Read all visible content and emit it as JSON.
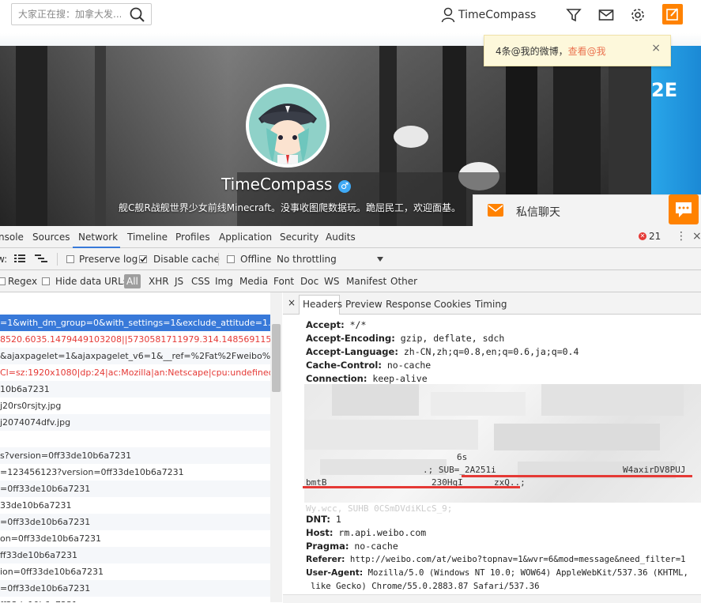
{
  "topbar": {
    "search_placeholder": "大家正在搜：加拿大发...",
    "username": "TimeCompass"
  },
  "notification": {
    "text": "4条@我的微博，",
    "link": "查看@我",
    "close": "×"
  },
  "banner": {
    "right_text": "2E"
  },
  "profile": {
    "name": "TimeCompass",
    "gender_icon": "♂",
    "bio": "舰C舰R战舰世界少女前线Minecraft。没事收图爬数据玩。跪屈民工，欢迎面基。"
  },
  "chat": {
    "label": "私信聊天"
  },
  "devtools": {
    "tabs": [
      "nsole",
      "Sources",
      "Network",
      "Timeline",
      "Profiles",
      "Application",
      "Security",
      "Audits"
    ],
    "error_count": "21",
    "more": "⋮",
    "close": "×",
    "toolbar": {
      "view_label": "w:",
      "preserve_log": "Preserve log",
      "disable_cache": "Disable cache",
      "offline": "Offline",
      "throttling": "No throttling"
    },
    "filter": {
      "regex": "Regex",
      "hide_data_urls": "Hide data URLs",
      "types": [
        "All",
        "XHR",
        "JS",
        "CSS",
        "Img",
        "Media",
        "Font",
        "Doc",
        "WS",
        "Manifest",
        "Other"
      ]
    },
    "requests": [
      "=1&with_dm_group=0&with_settings=1&exclude_attitude=1...",
      "8520.6035.1479449103208||5730581711979.314.148569115738...",
      "&ajaxpagelet=1&ajaxpagelet_v6=1&__ref=%2Fat%2Fweibo%3...",
      "Cl=sz:1920x1080|dp:24|ac:Mozilla|an:Netscape|cpu:undefined|p...",
      "10b6a7231",
      "j20rs0rsjty.jpg",
      "j2074074dfv.jpg",
      "",
      "s?version=0ff33de10b6a7231",
      "=123456123?version=0ff33de10b6a7231",
      "=0ff33de10b6a7231",
      "33de10b6a7231",
      "=0ff33de10b6a7231",
      "on=0ff33de10b6a7231",
      "ff33de10b6a7231",
      "ion=0ff33de10b6a7231",
      "=0ff33de10b6a7231",
      "ff33de10b6a7231"
    ],
    "header_tabs": [
      "Headers",
      "Preview",
      "Response",
      "Cookies",
      "Timing"
    ],
    "header_close": "×",
    "headers": [
      {
        "key": "Accept:",
        "value": " */*"
      },
      {
        "key": "Accept-Encoding:",
        "value": " gzip, deflate, sdch"
      },
      {
        "key": "Accept-Language:",
        "value": " zh-CN,zh;q=0.8,en;q=0.6,ja;q=0.4"
      },
      {
        "key": "Cache-Control:",
        "value": " no-cache"
      },
      {
        "key": "Connection:",
        "value": " keep-alive"
      },
      {
        "key": "Cookie:",
        "value": ""
      }
    ],
    "cookie_fragments": {
      "sub": ".; SUB=_2A251i",
      "tail": "W4axirDV8PUJ",
      "bmt": "bmtB",
      "mid": "230HqI",
      "zx": "zxQ..;",
      "six": "6s",
      "wy": "Wy.wcc, SUHB 0CSmDVdiKLcS_9;"
    },
    "headers_after": [
      {
        "key": "DNT:",
        "value": " 1"
      },
      {
        "key": "Host:",
        "value": " rm.api.weibo.com"
      },
      {
        "key": "Pragma:",
        "value": " no-cache"
      },
      {
        "key": "Referer:",
        "value": " http://weibo.com/at/weibo?topnav=1&wvr=6&mod=message&need_filter=1"
      },
      {
        "key": "User-Agent:",
        "value": " Mozilla/5.0 (Windows NT 10.0; WOW64) AppleWebKit/537.36 (KHTML,"
      }
    ],
    "ua_cont": "like Gecko) Chrome/55.0.2883.87 Safari/537.36"
  },
  "colors": {
    "accent": "#ff8200",
    "devtools_blue": "#3879d9",
    "error_red": "#e53935",
    "link_orange": "#eb7350"
  }
}
